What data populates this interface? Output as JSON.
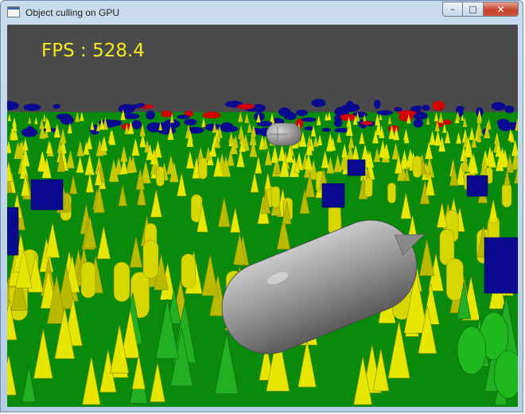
{
  "window": {
    "title": "Object culling on GPU",
    "minimize_symbol": "–",
    "maximize_symbol": "□",
    "close_symbol": "✕"
  },
  "hud": {
    "fps_text": "FPS : 528.4"
  },
  "scene": {
    "sky_color": "#4a4a4a",
    "ground_color": "#0a8a0a",
    "tree_color": "#e6e600",
    "near_tree_color": "#22b022",
    "box_color": "#0a0a90",
    "red_color": "#d00000",
    "capsule_color": "#9a9a9a"
  }
}
